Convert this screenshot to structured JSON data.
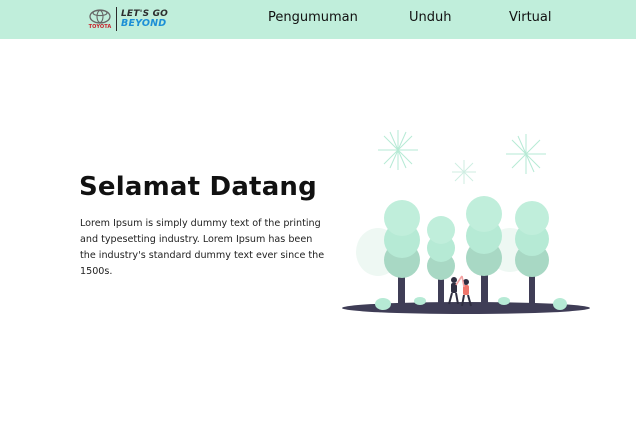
{
  "header": {
    "logo": {
      "emblem_text": "TOYOTA",
      "tagline_top": "LET'S GO",
      "tagline_bottom": "BEYOND"
    },
    "nav": [
      {
        "label": "Pengumuman"
      },
      {
        "label": "Unduh"
      },
      {
        "label": "Virtual"
      }
    ]
  },
  "hero": {
    "title": "Selamat Datang",
    "body": "Lorem Ipsum is simply dummy text of the printing and typesetting industry. Lorem Ipsum has been the industry's standard dummy text ever since the 1500s."
  },
  "colors": {
    "header_bg": "#c0eedb",
    "accent_mint": "#b6ead5",
    "tree_trunk": "#3f3d56",
    "brand_red": "#c8202a",
    "brand_blue": "#1c8fd6"
  }
}
